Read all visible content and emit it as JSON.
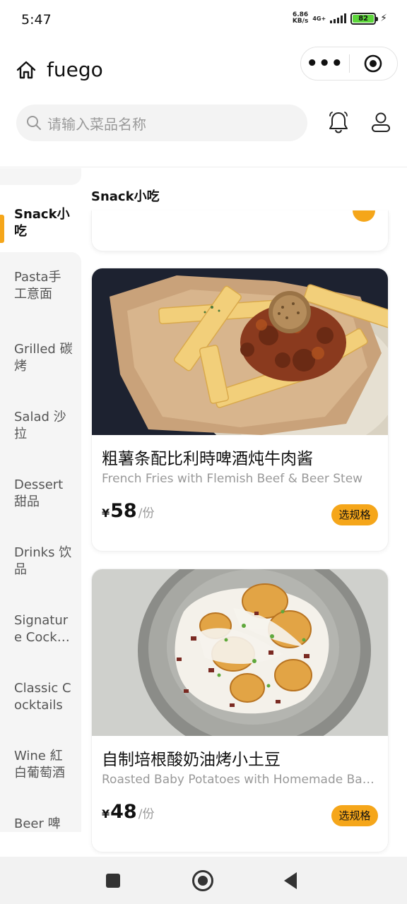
{
  "status_bar": {
    "time": "5:47",
    "net_speed_value": "6.86",
    "net_speed_unit": "KB/s",
    "network": "4G+",
    "battery": "82"
  },
  "header": {
    "title": "fuego",
    "more_icon": "more-dots-icon",
    "close_icon": "target-close-icon"
  },
  "search": {
    "placeholder": "请输入菜品名称"
  },
  "sidebar": {
    "items": [
      {
        "label": "Snack小吃",
        "active": true
      },
      {
        "label": "Pasta手工意面"
      },
      {
        "label": "Grilled 碳烤"
      },
      {
        "label": "Salad 沙拉"
      },
      {
        "label": "Dessert 甜品"
      },
      {
        "label": "Drinks 饮品"
      },
      {
        "label": "Signature Cocktails"
      },
      {
        "label": "Classic Cocktails"
      },
      {
        "label": "Wine 紅白葡萄酒"
      },
      {
        "label": "Beer 啤"
      }
    ]
  },
  "main": {
    "section_title": "Snack小吃",
    "dishes": [
      {
        "name": "粗薯条配比利時啤酒炖牛肉酱",
        "name_en": "French Fries with Flemish Beef & Beer Stew",
        "currency": "¥",
        "price": "58",
        "unit": "/份",
        "button": "选规格"
      },
      {
        "name": "自制培根酸奶油烤小土豆",
        "name_en": "Roasted Baby Potatoes with Homemade Bacon & Sour Cream",
        "currency": "¥",
        "price": "48",
        "unit": "/份",
        "button": "选规格"
      }
    ]
  },
  "colors": {
    "accent": "#f5a61a",
    "sidebar_bg": "#f5f5f5"
  }
}
